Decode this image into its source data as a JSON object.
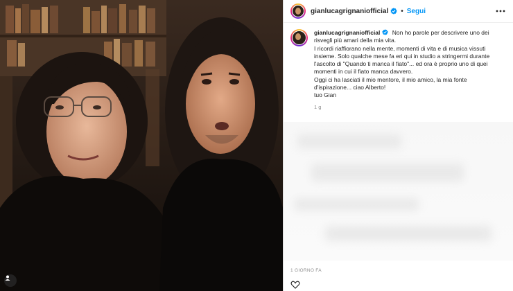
{
  "post": {
    "username": "gianlucagrignaniofficial",
    "separator": "•",
    "follow_label": "Segui",
    "caption_user": "gianlucagrignaniofficial",
    "caption_text": " Non ho parole per descrivere uno dei risvegli più amari della mia vita.\nI ricordi riaffiorano nella mente, momenti di vita e di musica vissuti insieme. Solo qualche mese fa eri qui in studio a stringermi durante l'ascolto di \"Quando ti manca il fiato\"... ed ora è proprio uno di quei momenti in cui il fiato manca davvero.\nOggi ci ha lasciati il mio mentore, il mio amico, la mia fonte d'ispirazione... ciao Alberto!\ntuo Gian",
    "time_ago": "1 g",
    "date_label": "1 GIORNO FA"
  },
  "icons": {
    "verified": "verified-badge-icon",
    "more": "more-options-icon",
    "media_corner": "user-tag-icon",
    "like": "heart-icon"
  },
  "colors": {
    "follow": "#0095f6",
    "verified": "#0095f6",
    "muted": "#8e8e8e"
  }
}
